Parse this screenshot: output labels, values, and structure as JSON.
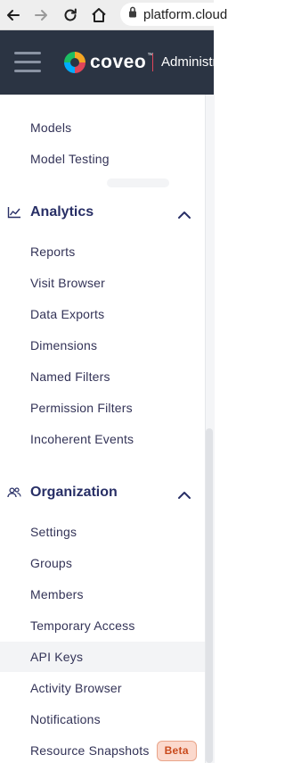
{
  "browser": {
    "url": "platform.cloud"
  },
  "header": {
    "logo_text": "coveo",
    "logo_tm": "™",
    "admin_label": "Administration"
  },
  "sidebar": {
    "top_items": [
      {
        "label": "Models"
      },
      {
        "label": "Model Testing"
      }
    ],
    "analytics": {
      "title": "Analytics",
      "icon": "line-chart-icon",
      "items": [
        {
          "label": "Reports"
        },
        {
          "label": "Visit Browser"
        },
        {
          "label": "Data Exports"
        },
        {
          "label": "Dimensions"
        },
        {
          "label": "Named Filters"
        },
        {
          "label": "Permission Filters"
        },
        {
          "label": "Incoherent Events"
        }
      ]
    },
    "organization": {
      "title": "Organization",
      "icon": "people-icon",
      "items": [
        {
          "label": "Settings"
        },
        {
          "label": "Groups"
        },
        {
          "label": "Members"
        },
        {
          "label": "Temporary Access"
        },
        {
          "label": "API Keys",
          "active": true
        },
        {
          "label": "Activity Browser"
        },
        {
          "label": "Notifications"
        },
        {
          "label": "Resource Snapshots",
          "badge": "Beta"
        }
      ]
    }
  },
  "colors": {
    "header_bg": "#2b3443",
    "section_title": "#282f66",
    "item_text": "#333357",
    "badge_bg": "#fbd9cd",
    "badge_text": "#c94a1c"
  }
}
